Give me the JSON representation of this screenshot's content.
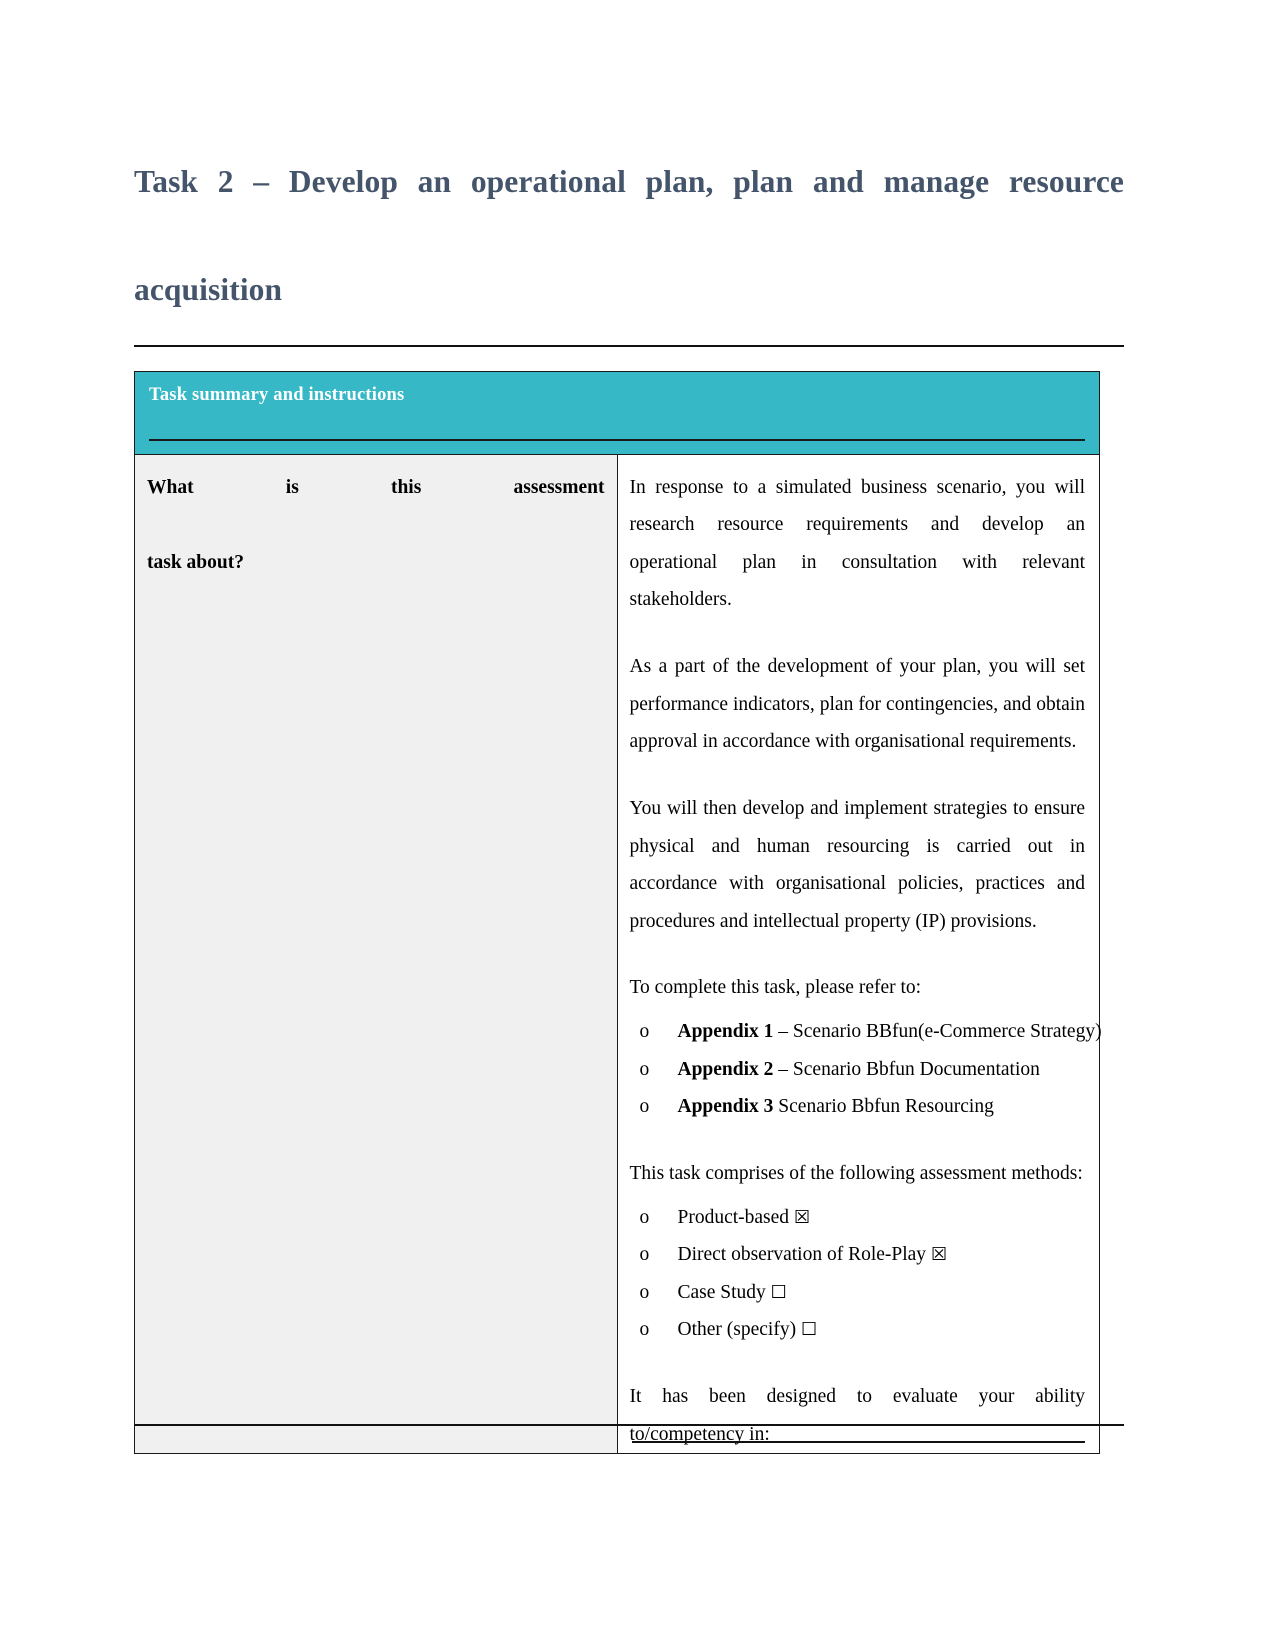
{
  "document": {
    "title_line1": "Task 2 – Develop an operational plan, plan and manage resource",
    "title_line2": "acquisition",
    "title_color": "#44546a"
  },
  "table": {
    "header": {
      "label": "Task summary and instructions",
      "background_color": "#36b8c6",
      "text_color": "#ffffff"
    },
    "row": {
      "label_line1": "What is this assessment",
      "label_line2": "task about?",
      "label_background_color": "#f0f0f0",
      "paragraphs": [
        "In response to a simulated business scenario, you will research resource requirements and develop an operational plan in consultation with relevant stakeholders.",
        "As a part of the development of your plan, you will set performance indicators, plan for contingencies, and obtain approval in accordance with organisational requirements.",
        "You will then develop and implement strategies to ensure physical and human resourcing is carried out in accordance with organisational policies, practices and procedures and intellectual property (IP) provisions."
      ],
      "refer_intro": "To complete this task, please refer to:",
      "appendices": [
        {
          "bullet": "o",
          "name": "Appendix 1",
          "description": " – Scenario BBfun(e-Commerce Strategy)"
        },
        {
          "bullet": "o",
          "name": "Appendix 2",
          "description": " – Scenario Bbfun Documentation"
        },
        {
          "bullet": "o",
          "name": "Appendix 3",
          "description": " Scenario Bbfun Resourcing"
        }
      ],
      "methods_intro": "This task comprises of the following assessment methods:",
      "methods": [
        {
          "bullet": "o",
          "label": "Product-based",
          "checkbox": "☒",
          "checked": true
        },
        {
          "bullet": "o",
          "label": "Direct observation of Role-Play",
          "checkbox": "☒",
          "checked": true
        },
        {
          "bullet": "o",
          "label": "Case Study",
          "checkbox": "☐",
          "checked": false
        },
        {
          "bullet": "o",
          "label": "Other (specify)",
          "checkbox": "☐",
          "checked": false
        }
      ],
      "closing": "It has been designed to evaluate your ability to/competency in:"
    }
  }
}
